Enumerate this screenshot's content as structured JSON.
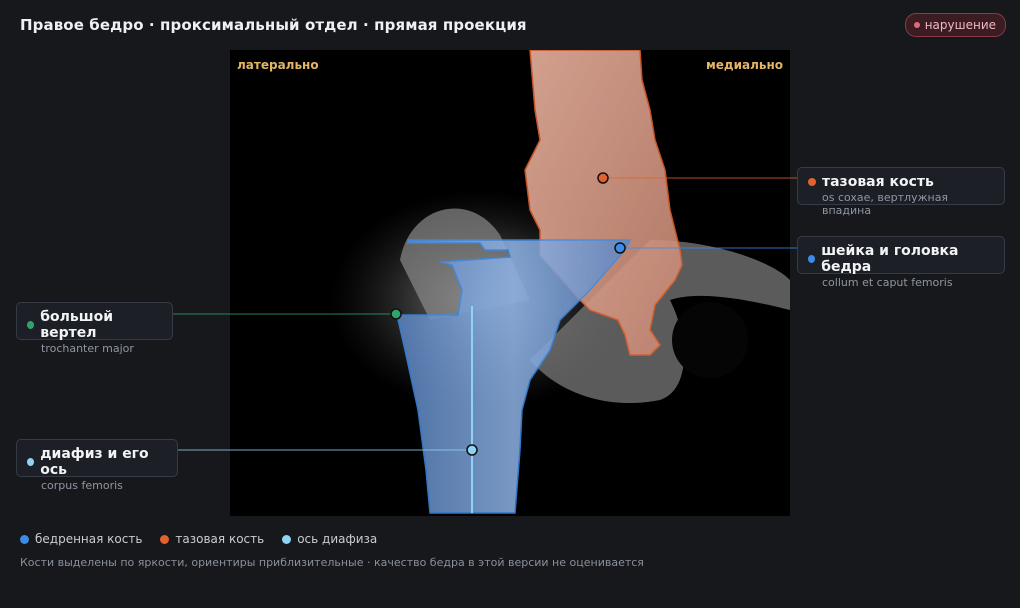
{
  "header": {
    "title": "Правое бедро · проксимальный отдел · прямая проекция",
    "status_badge": "нарушение"
  },
  "viewer": {
    "orient_left": "латерально",
    "orient_right": "медиально"
  },
  "annotations": {
    "pelvis": {
      "title": "тазовая кость",
      "subtitle": "os coxae, вертлужная впадина",
      "color": "#e2612e"
    },
    "femoral_neck": {
      "title": "шейка и головка бедра",
      "subtitle": "collum et caput femoris",
      "color": "#3b8be8"
    },
    "greater_trochanter": {
      "title": "большой вертел",
      "subtitle": "trochanter major",
      "color": "#2fa36b"
    },
    "shaft": {
      "title": "диафиз и его ось",
      "subtitle": "corpus femoris",
      "color": "#8fd3f4"
    }
  },
  "legend": [
    {
      "label": "бедренная кость",
      "color": "#3b8be8"
    },
    {
      "label": "тазовая кость",
      "color": "#e2612e"
    },
    {
      "label": "ось диафиза",
      "color": "#8fd3f4"
    }
  ],
  "footer_note": "Кости выделены по яркости, ориентиры приблизительные · качество бедра в этой версии не оценивается"
}
